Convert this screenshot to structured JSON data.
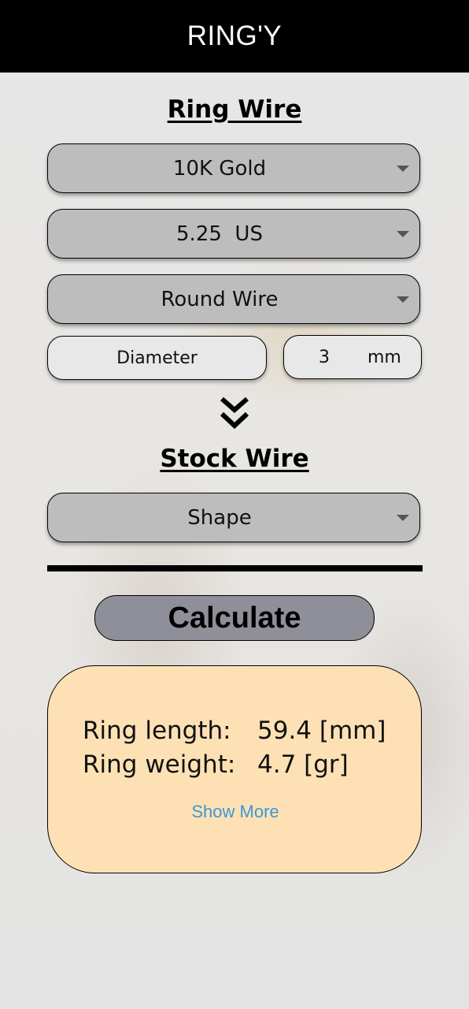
{
  "app_bar": {
    "title": "RING'Y"
  },
  "ring_wire": {
    "title": "Ring Wire",
    "material": "10K Gold",
    "size": "5.25  US",
    "profile": "Round Wire",
    "dimension_label": "Diameter",
    "dimension_value": "3",
    "dimension_unit": "mm"
  },
  "stock_wire": {
    "title": "Stock Wire",
    "shape": "Shape"
  },
  "calculate_label": "Calculate",
  "results": {
    "length_label": "Ring length:",
    "length_value": "59.4 [mm]",
    "weight_label": "Ring weight:",
    "weight_value": "4.7 [gr]",
    "show_more": "Show More"
  },
  "icons": {
    "dropdown": "chevron-down-icon",
    "arrow": "double-chevron-down-icon"
  }
}
